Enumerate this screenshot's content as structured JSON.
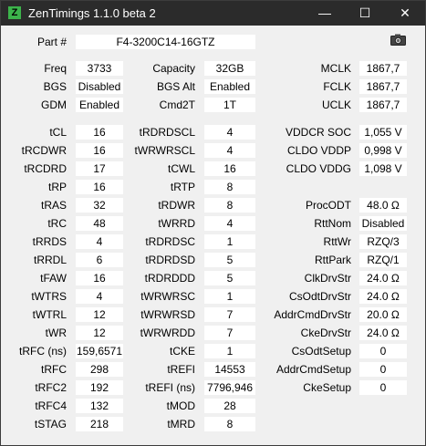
{
  "window": {
    "title": "ZenTimings 1.1.0 beta 2",
    "app_icon_letter": "Z",
    "minimize": "—",
    "maximize": "☐",
    "close": "✕"
  },
  "part": {
    "label": "Part #",
    "value": "F4-3200C14-16GTZ"
  },
  "top": [
    {
      "label": "Freq",
      "value": "3733"
    },
    {
      "label": "BGS",
      "value": "Disabled"
    },
    {
      "label": "GDM",
      "value": "Enabled"
    }
  ],
  "top_mid": [
    {
      "label": "Capacity",
      "value": "32GB"
    },
    {
      "label": "BGS Alt",
      "value": "Enabled"
    },
    {
      "label": "Cmd2T",
      "value": "1T"
    }
  ],
  "top_right": [
    {
      "label": "MCLK",
      "value": "1867,7"
    },
    {
      "label": "FCLK",
      "value": "1867,7"
    },
    {
      "label": "UCLK",
      "value": "1867,7"
    }
  ],
  "col1": [
    {
      "label": "tCL",
      "value": "16"
    },
    {
      "label": "tRCDWR",
      "value": "16"
    },
    {
      "label": "tRCDRD",
      "value": "17"
    },
    {
      "label": "tRP",
      "value": "16"
    },
    {
      "label": "tRAS",
      "value": "32"
    },
    {
      "label": "tRC",
      "value": "48"
    },
    {
      "label": "tRRDS",
      "value": "4"
    },
    {
      "label": "tRRDL",
      "value": "6"
    },
    {
      "label": "tFAW",
      "value": "16"
    },
    {
      "label": "tWTRS",
      "value": "4"
    },
    {
      "label": "tWTRL",
      "value": "12"
    },
    {
      "label": "tWR",
      "value": "12"
    },
    {
      "label": "tRFC (ns)",
      "value": "159,6571"
    },
    {
      "label": "tRFC",
      "value": "298"
    },
    {
      "label": "tRFC2",
      "value": "192"
    },
    {
      "label": "tRFC4",
      "value": "132"
    },
    {
      "label": "tSTAG",
      "value": "218"
    }
  ],
  "col2": [
    {
      "label": "tRDRDSCL",
      "value": "4"
    },
    {
      "label": "tWRWRSCL",
      "value": "4"
    },
    {
      "label": "tCWL",
      "value": "16"
    },
    {
      "label": "tRTP",
      "value": "8"
    },
    {
      "label": "tRDWR",
      "value": "8"
    },
    {
      "label": "tWRRD",
      "value": "4"
    },
    {
      "label": "tRDRDSC",
      "value": "1"
    },
    {
      "label": "tRDRDSD",
      "value": "5"
    },
    {
      "label": "tRDRDDD",
      "value": "5"
    },
    {
      "label": "tWRWRSC",
      "value": "1"
    },
    {
      "label": "tWRWRSD",
      "value": "7"
    },
    {
      "label": "tWRWRDD",
      "value": "7"
    },
    {
      "label": "tCKE",
      "value": "1"
    },
    {
      "label": "tREFI",
      "value": "14553"
    },
    {
      "label": "tREFI (ns)",
      "value": "7796,946"
    },
    {
      "label": "tMOD",
      "value": "28"
    },
    {
      "label": "tMRD",
      "value": "8"
    }
  ],
  "col3": [
    {
      "label": "VDDCR SOC",
      "value": "1,055 V"
    },
    {
      "label": "CLDO VDDP",
      "value": "0,998 V"
    },
    {
      "label": "CLDO VDDG",
      "value": "1,098 V"
    },
    {
      "label": "",
      "value": ""
    },
    {
      "label": "ProcODT",
      "value": "48.0 Ω"
    },
    {
      "label": "RttNom",
      "value": "Disabled"
    },
    {
      "label": "RttWr",
      "value": "RZQ/3"
    },
    {
      "label": "RttPark",
      "value": "RZQ/1"
    },
    {
      "label": "ClkDrvStr",
      "value": "24.0 Ω"
    },
    {
      "label": "CsOdtDrvStr",
      "value": "24.0 Ω"
    },
    {
      "label": "AddrCmdDrvStr",
      "value": "20.0 Ω"
    },
    {
      "label": "CkeDrvStr",
      "value": "24.0 Ω"
    },
    {
      "label": "CsOdtSetup",
      "value": "0"
    },
    {
      "label": "AddrCmdSetup",
      "value": "0"
    },
    {
      "label": "CkeSetup",
      "value": "0"
    }
  ],
  "icons": {
    "screenshot": "camera-icon"
  }
}
